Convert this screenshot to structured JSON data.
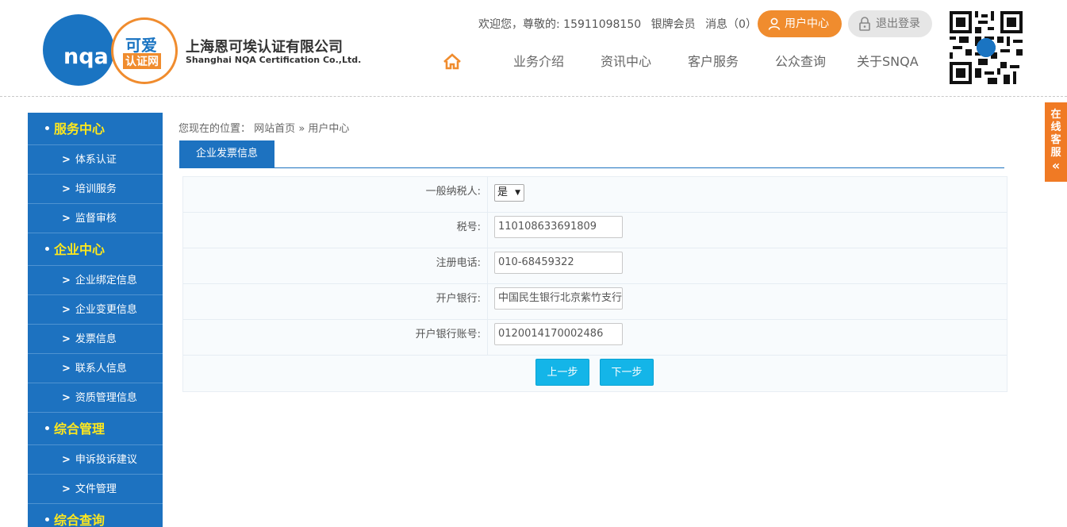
{
  "header": {
    "logo": {
      "nqa": "nqa",
      "keai": "可爱",
      "renzheng": "认证网"
    },
    "company_cn": "上海恩可埃认证有限公司",
    "company_en": "Shanghai NQA Certification Co.,Ltd.",
    "welcome": "欢迎您，尊敬的: 15911098150",
    "member": "银牌会员",
    "messages": "消息（0）",
    "user_center": "用户中心",
    "logout": "退出登录",
    "nav": [
      "业务介绍",
      "资讯中心",
      "客户服务",
      "公众查询",
      "关于SNQA"
    ]
  },
  "sidebar": {
    "sections": [
      {
        "title": "服务中心",
        "items": [
          "体系认证",
          "培训服务",
          "监督审核"
        ]
      },
      {
        "title": "企业中心",
        "items": [
          "企业绑定信息",
          "企业变更信息",
          "发票信息",
          "联系人信息",
          "资质管理信息"
        ]
      },
      {
        "title": "综合管理",
        "items": [
          "申诉投诉建议",
          "文件管理"
        ]
      },
      {
        "title": "综合查询",
        "items": []
      }
    ]
  },
  "breadcrumb": {
    "prefix": "您现在的位置：",
    "home": "网站首页",
    "sep": "»",
    "current": "用户中心"
  },
  "tab": {
    "label": "企业发票信息"
  },
  "form": {
    "taxpayer": {
      "label": "一般纳税人:",
      "value": "是"
    },
    "tax_no": {
      "label": "税号:",
      "value": "110108633691809"
    },
    "phone": {
      "label": "注册电话:",
      "value": "010-68459322"
    },
    "bank": {
      "label": "开户银行:",
      "value": "中国民生银行北京紫竹支行"
    },
    "account": {
      "label": "开户银行账号:",
      "value": "0120014170002486"
    },
    "prev": "上一步",
    "next": "下一步"
  },
  "float_service": {
    "chars": [
      "在",
      "线",
      "客",
      "服"
    ],
    "arrow": "«"
  },
  "colors": {
    "primary": "#1d72c0",
    "accent": "#f08c2e",
    "button": "#14b5e8",
    "side_title": "#ffe81d"
  }
}
